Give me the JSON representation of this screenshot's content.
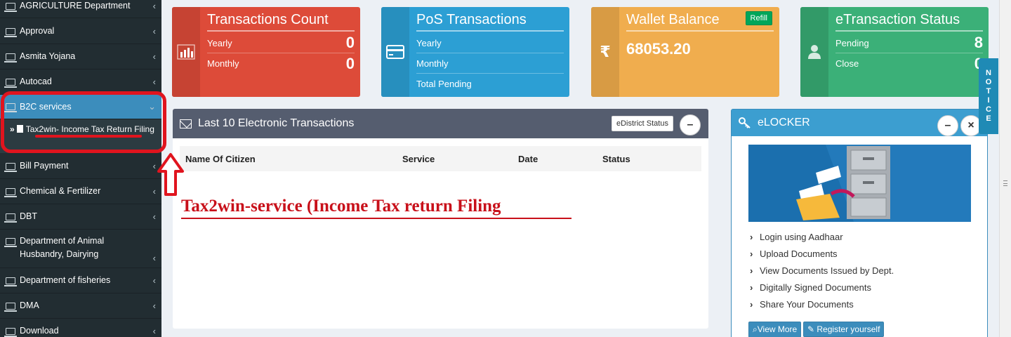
{
  "sidebar": {
    "items": [
      {
        "label": "AGRICULTURE Department"
      },
      {
        "label": "Approval"
      },
      {
        "label": "Asmita Yojana"
      },
      {
        "label": "Autocad"
      },
      {
        "label": "B2C services"
      },
      {
        "label": "Bill Payment"
      },
      {
        "label": "Chemical & Fertilizer"
      },
      {
        "label": "DBT"
      },
      {
        "label": "Department of Animal Husbandry, Dairying"
      },
      {
        "label": "Department of fisheries"
      },
      {
        "label": "DMA"
      },
      {
        "label": "Download"
      }
    ],
    "submenu_item": "Tax2win- Income Tax Return Filing"
  },
  "cards": {
    "transactions": {
      "title": "Transactions Count",
      "yearly_label": "Yearly",
      "yearly_value": "0",
      "monthly_label": "Monthly",
      "monthly_value": "0"
    },
    "pos": {
      "title": "PoS Transactions",
      "yearly_label": "Yearly",
      "monthly_label": "Monthly",
      "pending_label": "Total Pending"
    },
    "wallet": {
      "title": "Wallet Balance",
      "refill_label": "Refill",
      "currency_symbol": "₹",
      "amount": "68053.20"
    },
    "etransaction": {
      "title": "eTransaction Status",
      "pending_label": "Pending",
      "pending_value": "8",
      "close_label": "Close",
      "close_value": "0"
    }
  },
  "transactions_panel": {
    "title": "Last 10 Electronic Transactions",
    "edistrict_button": "eDistrict Status",
    "minimize_symbol": "–",
    "columns": [
      "Name Of Citizen",
      "Service",
      "Date",
      "Status"
    ]
  },
  "annotation": {
    "text": "Tax2win-service (Income Tax return Filing"
  },
  "elocker": {
    "title": "eLOCKER",
    "minimize_symbol": "–",
    "close_symbol": "×",
    "links": [
      "Login using Aadhaar",
      "Upload Documents",
      "View Documents Issued by Dept.",
      "Digitally Signed Documents",
      "Share Your Documents"
    ],
    "view_more_label": "View More",
    "register_label": "Register yourself"
  },
  "notice_tab": {
    "label": "NOTICE"
  },
  "colors": {
    "red": "#dd4b39",
    "blue": "#2c9fd4",
    "yellow": "#f0ad4e",
    "green": "#3bb078",
    "sidebar": "#222d32",
    "active": "#3c8dbc",
    "annotation": "#e0141e"
  }
}
